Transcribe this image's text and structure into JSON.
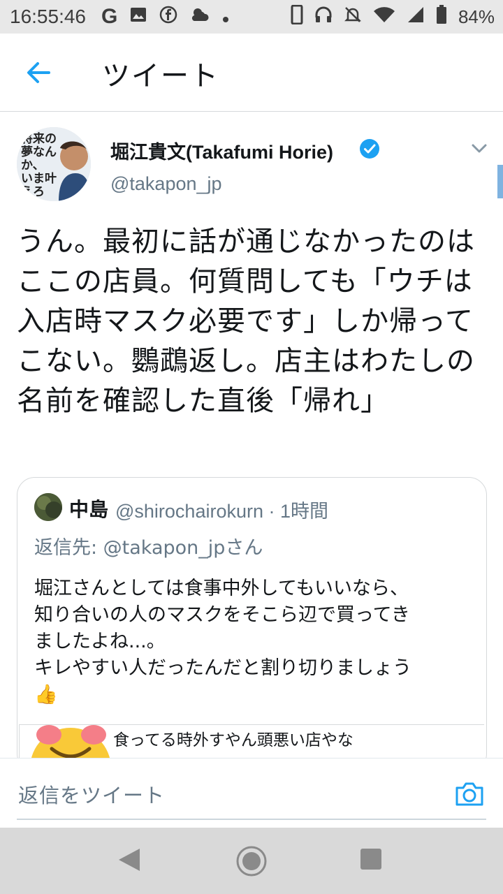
{
  "status_bar": {
    "time": "16:55:46",
    "battery": "84%",
    "left_icons": [
      "google-icon",
      "image-icon",
      "facebook-icon",
      "weather-icon",
      "dot-icon"
    ],
    "right_icons": [
      "phone-icon",
      "headset-icon",
      "mute-icon",
      "wifi-icon",
      "signal-icon",
      "battery-icon"
    ]
  },
  "top_bar": {
    "back_icon": "arrow-left-icon",
    "title": "ツイート",
    "accent_color": "#1da1f2"
  },
  "tweet": {
    "author_name": "堀江貴文(Takafumi Horie)",
    "handle": "@takapon_jp",
    "verified": true,
    "text": "うん。最初に話が通じなかったのはここの店員。何質問しても「ウチは入店時マスク必要です」しか帰ってこない。鸚鵡返し。店主はわたしの名前を確認した直後「帰れ」",
    "avatar_book_text": [
      "将来の",
      "夢なんか、",
      "いま叶えろ"
    ]
  },
  "quoted_tweet": {
    "name": "中島",
    "handle_time": "@shirochairokurn · 1時間",
    "reply_to": "返信先: @takapon_jpさん",
    "text_lines": [
      "堀江さんとしては食事中外してもいいなら、",
      "知り合いの人のマスクをそこら辺で買ってき",
      "ましたよね...。",
      "キレやすい人だったんだと割り切りましょう",
      "👍"
    ],
    "embedded_text": "食ってる時外すやん頭悪い店やな"
  },
  "reply_bar": {
    "placeholder": "返信をツイート",
    "camera_icon": "camera-icon"
  },
  "nav_bar": {
    "icons": [
      "back-triangle-icon",
      "home-circle-icon",
      "recents-square-icon"
    ]
  }
}
